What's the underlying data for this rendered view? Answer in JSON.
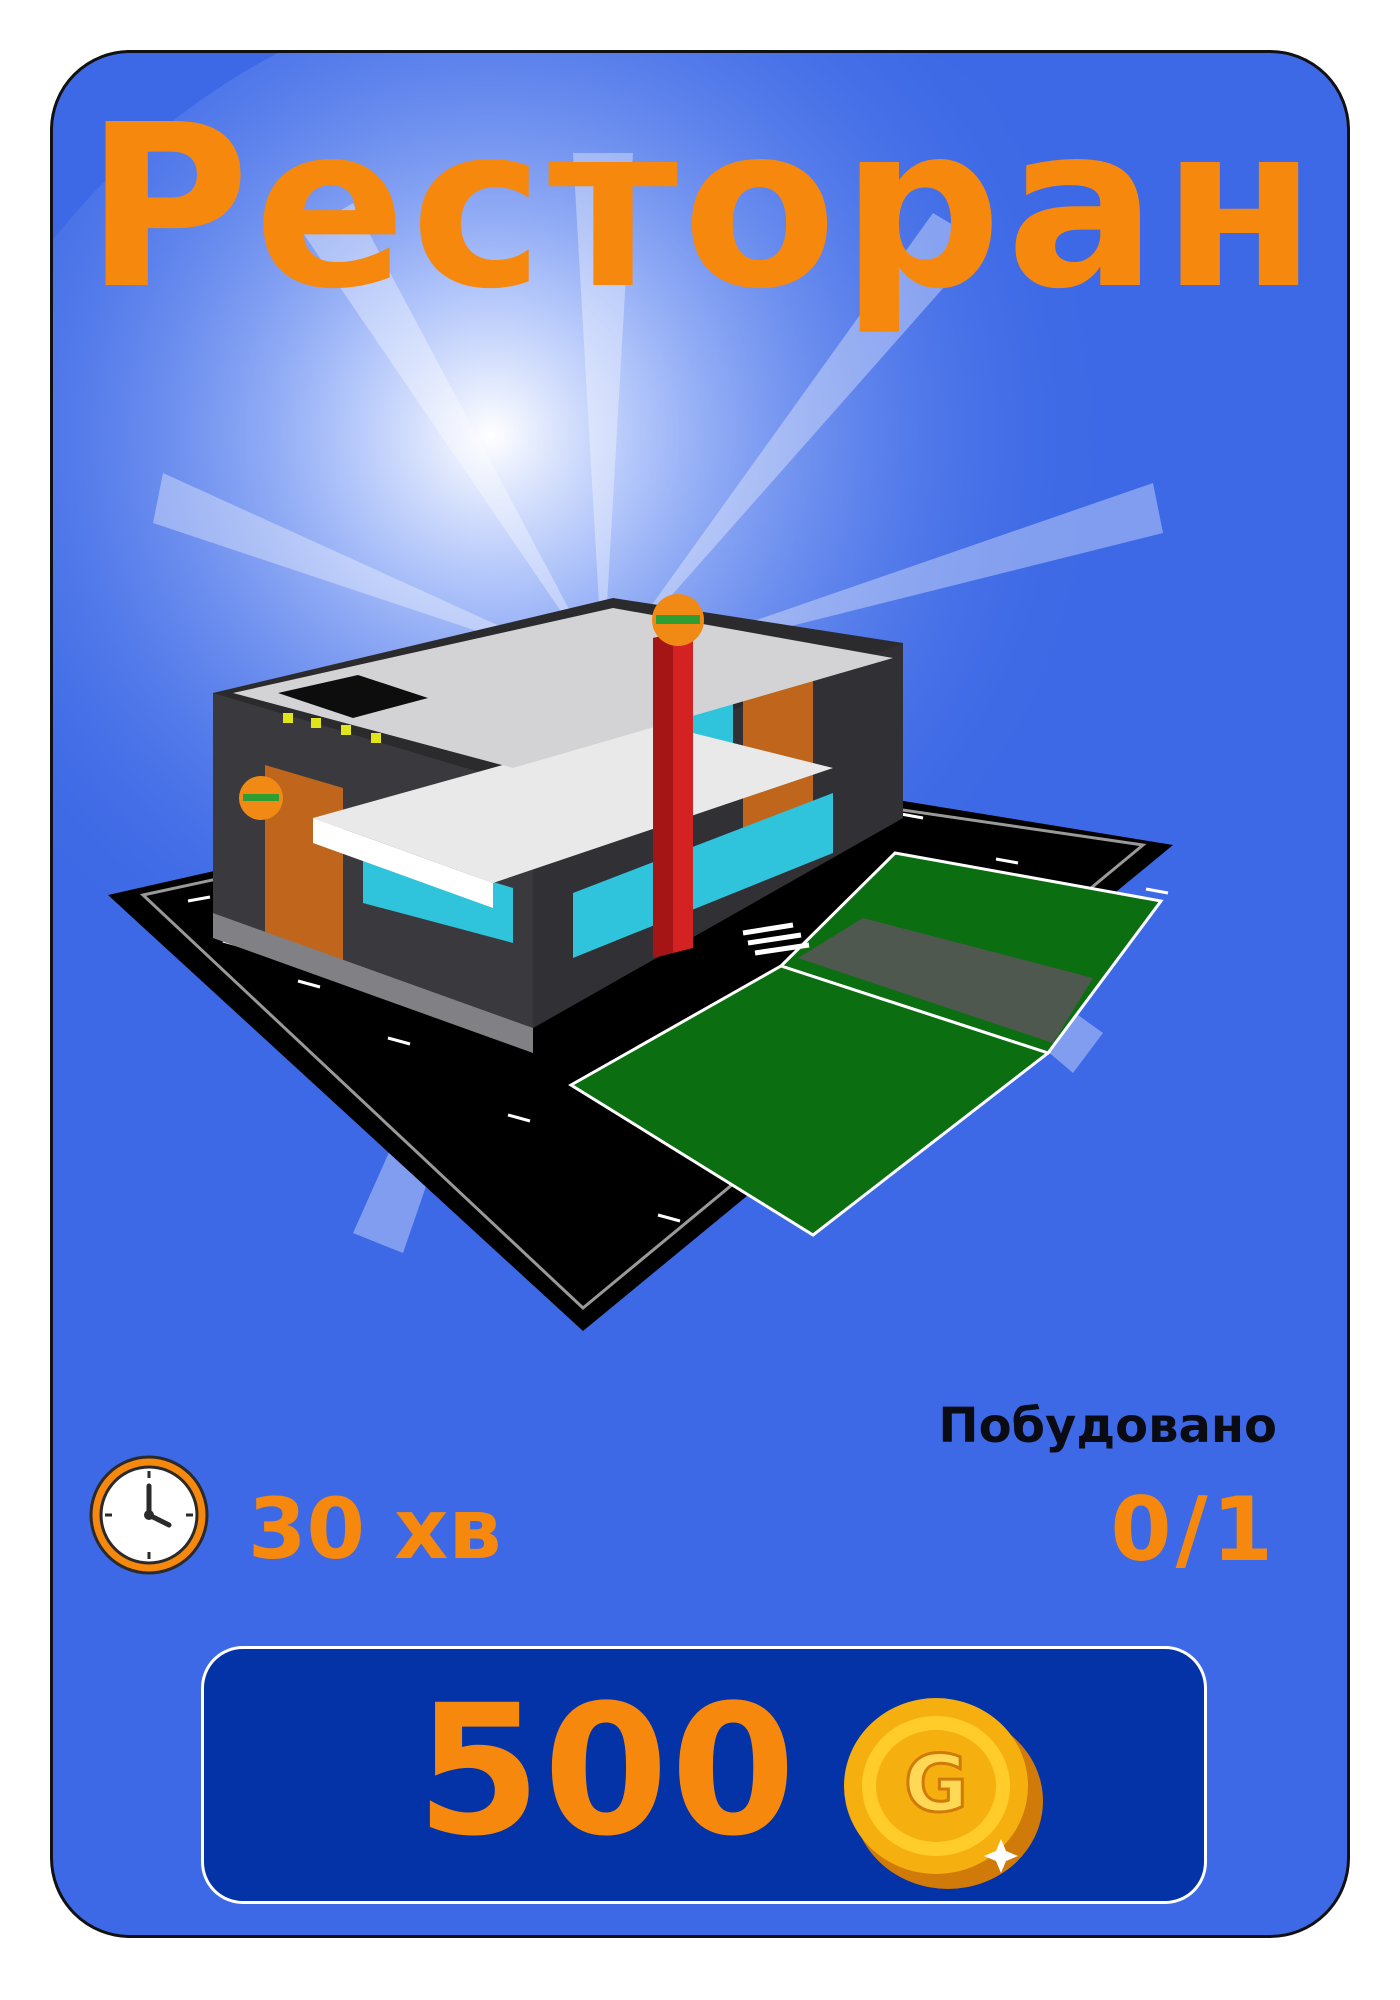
{
  "card": {
    "title": "Ресторан",
    "background_color": "#3d69e6",
    "accent_color": "#f7880e"
  },
  "stats": {
    "built_label": "Побудовано",
    "built_count": "0/1",
    "build_time": "30 хв",
    "time_icon": "clock-icon"
  },
  "price": {
    "amount": "500",
    "currency_icon": "gold-coin-icon",
    "currency_letter": "G"
  }
}
